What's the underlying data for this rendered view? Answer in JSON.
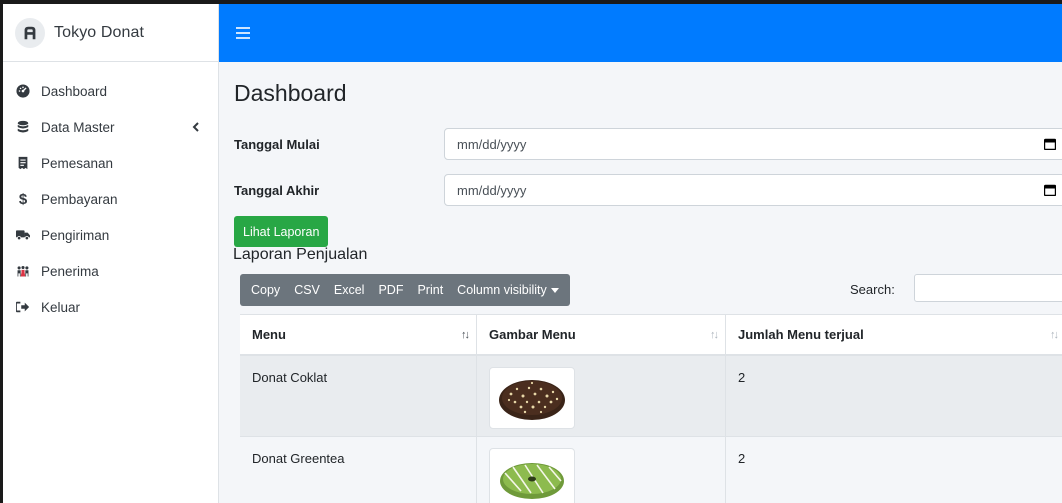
{
  "brand": {
    "name": "Tokyo Donat",
    "logo_icon": "adminlte-logo-icon"
  },
  "sidebar": {
    "items": [
      {
        "label": "Dashboard",
        "icon": "tachometer-icon"
      },
      {
        "label": "Data Master",
        "icon": "database-icon",
        "has_submenu": true
      },
      {
        "label": "Pemesanan",
        "icon": "receipt-icon"
      },
      {
        "label": "Pembayaran",
        "icon": "dollar-icon"
      },
      {
        "label": "Pengiriman",
        "icon": "truck-icon"
      },
      {
        "label": "Penerima",
        "icon": "people-icon"
      },
      {
        "label": "Keluar",
        "icon": "sign-out-icon"
      }
    ]
  },
  "topbar": {
    "accent": "#007bff"
  },
  "page": {
    "title": "Dashboard"
  },
  "filters": {
    "start": {
      "label": "Tanggal Mulai",
      "placeholder": "mm/dd/yyyy"
    },
    "end": {
      "label": "Tanggal Akhir",
      "placeholder": "mm/dd/yyyy"
    },
    "submit_label": "Lihat Laporan"
  },
  "report": {
    "title": "Laporan Penjualan",
    "buttons": [
      "Copy",
      "CSV",
      "Excel",
      "PDF",
      "Print",
      "Column visibility"
    ],
    "search_label": "Search:",
    "search_value": "",
    "columns": [
      "Menu",
      "Gambar Menu",
      "Jumlah Menu terjual"
    ],
    "rows": [
      {
        "menu": "Donat Coklat",
        "image": "chocolate-donut-image",
        "jumlah": "2"
      },
      {
        "menu": "Donat Greentea",
        "image": "greentea-donut-image",
        "jumlah": "2"
      }
    ]
  },
  "colors": {
    "primary": "#007bff",
    "success": "#28a745",
    "secondary": "#6c757d",
    "content_bg": "#f4f6f9"
  }
}
